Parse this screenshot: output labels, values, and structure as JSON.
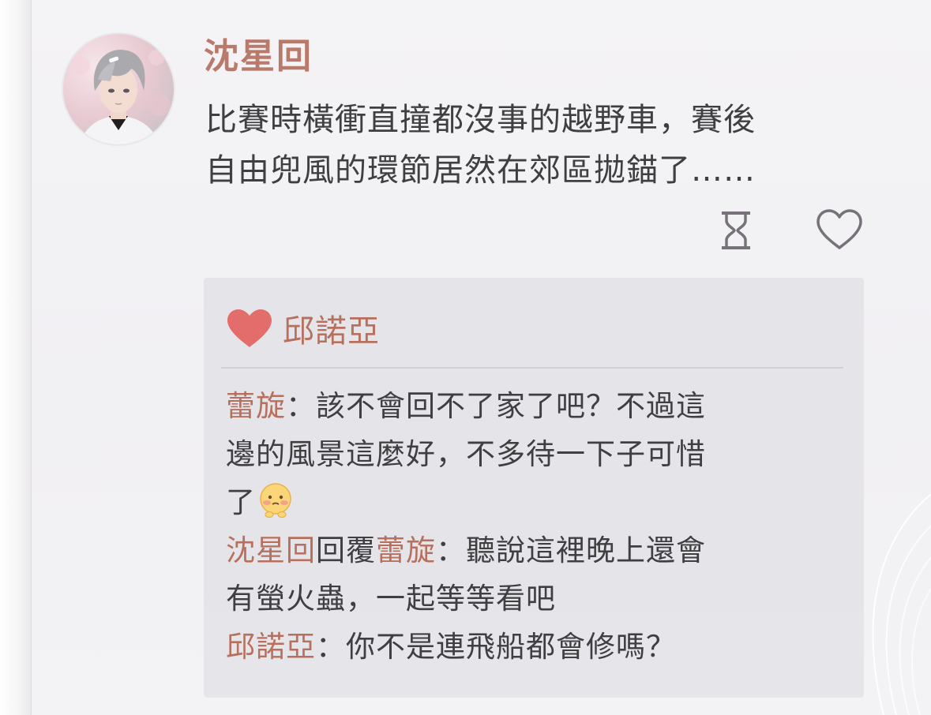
{
  "post": {
    "author": "沈星回",
    "text_lines": [
      "比賽時橫衝直撞都沒事的越野車，賽後",
      "自由兜風的環節居然在郊區拋錨了……"
    ],
    "icons": [
      "hourglass-icon",
      "heart-outline-icon"
    ]
  },
  "likes": {
    "icon": "heart-filled-icon",
    "names": "邱諾亞",
    "color": "#e36d6a"
  },
  "comments": [
    {
      "author": "蕾旋",
      "separator": "：",
      "lines": [
        "該不會回不了家了吧？不過這",
        "邊的風景這麼好，不多待一下子可惜",
        "了"
      ],
      "trailing_emoji": "blushing-face-emoji-icon"
    },
    {
      "author": "沈星回",
      "reply_word": "回覆",
      "reply_to": "蕾旋",
      "separator": "：",
      "lines": [
        "聽說這裡晚上還會",
        "有螢火蟲，一起等等看吧"
      ]
    },
    {
      "author": "邱諾亞",
      "separator": "：",
      "lines": [
        "你不是連飛船都會修嗎？"
      ]
    }
  ],
  "colors": {
    "name_accent": "#b6705d",
    "author_title": "#b87a6a",
    "body_text": "#3f3f42",
    "panel_bg": "#e1e1e5"
  }
}
